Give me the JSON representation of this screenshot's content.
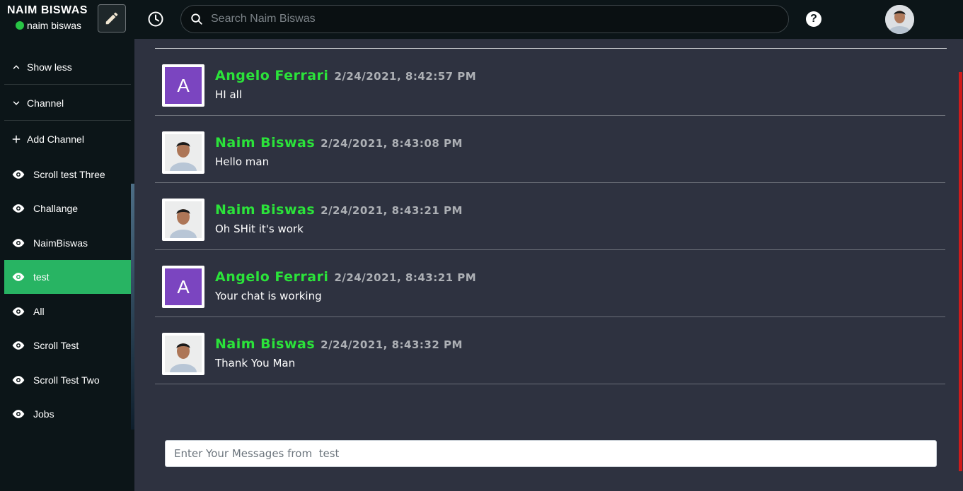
{
  "header": {
    "brand_title": "NAIM BISWAS",
    "username": "naim biswas",
    "online_color": "#28c445",
    "search_placeholder": "Search Naim Biswas",
    "help_label": "?"
  },
  "sidebar": {
    "toggles": [
      {
        "label": "Show less",
        "icon": "chevron-up-icon"
      },
      {
        "label": "Channel",
        "icon": "chevron-down-icon"
      },
      {
        "label": "Add Channel",
        "icon": "plus-icon"
      }
    ],
    "channels": [
      {
        "label": "Scroll test Three",
        "active": false
      },
      {
        "label": "Challange",
        "active": false
      },
      {
        "label": "NaimBiswas",
        "active": false
      },
      {
        "label": "test",
        "active": true
      },
      {
        "label": "All",
        "active": false
      },
      {
        "label": "Scroll Test",
        "active": false
      },
      {
        "label": "Scroll Test Two",
        "active": false
      },
      {
        "label": "Jobs",
        "active": false
      }
    ],
    "active_color": "#28b463"
  },
  "messages": [
    {
      "name": "Angelo Ferrari",
      "time": "2/24/2021, 8:42:57 PM",
      "text": "HI all",
      "avatar_letter": "A"
    },
    {
      "name": "Naim Biswas",
      "time": "2/24/2021, 8:43:08 PM",
      "text": "Hello man",
      "avatar_letter": ""
    },
    {
      "name": "Naim Biswas",
      "time": "2/24/2021, 8:43:21 PM",
      "text": "Oh SHit it's work",
      "avatar_letter": ""
    },
    {
      "name": "Angelo Ferrari",
      "time": "2/24/2021, 8:43:21 PM",
      "text": "Your chat is working",
      "avatar_letter": "A"
    },
    {
      "name": "Naim Biswas",
      "time": "2/24/2021, 8:43:32 PM",
      "text": "Thank You Man",
      "avatar_letter": ""
    }
  ],
  "composer": {
    "placeholder": "Enter Your Messages from  test"
  },
  "colors": {
    "name_color": "#2be33a",
    "letter_avatar_bg": "#7b45c0"
  }
}
